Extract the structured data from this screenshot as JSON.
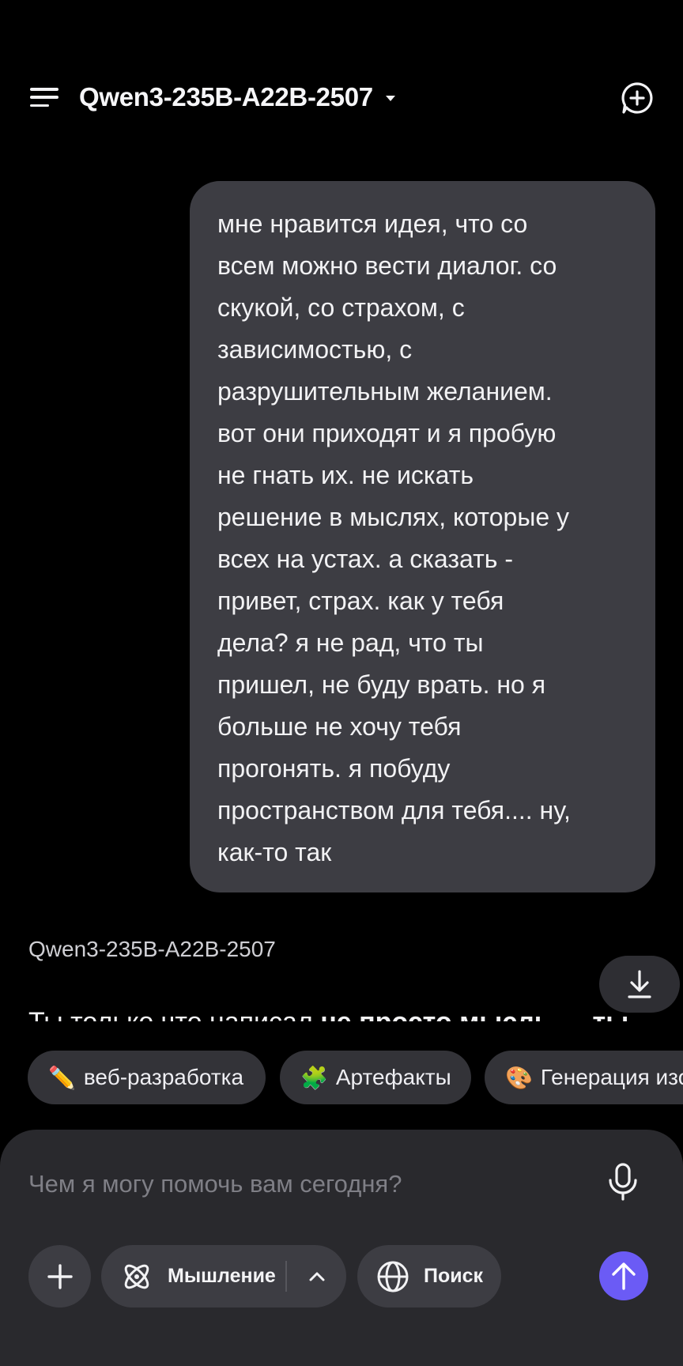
{
  "header": {
    "model_name": "Qwen3-235B-A22B-2507",
    "icons": {
      "menu": "hamburger-menu-icon",
      "dropdown": "caret-down-icon",
      "new_chat": "new-chat-bubble-plus-icon"
    }
  },
  "conversation": {
    "user_message": "мне нравится идея, что со\nвсем можно вести диалог. со\nскукой, со страхом, с\nзависимостью, с\nразрушительным желанием.\nвот они приходят и я пробую\nне гнать их. не искать\nрешение в мыслях, которые у\nвсех на устах. а сказать -\nпривет, страх. как у тебя\nдела? я не рад, что ты\nпришел, не буду врать. но я\nбольше не хочу тебя\nпрогонять. я побуду\nпространством для тебя.... ну,\nкак-то так",
    "assistant_name": "Qwen3-235B-A22B-2507",
    "assistant_preview_plain": "Ты только что написал ",
    "assistant_preview_bold": "не просто мысль — ты"
  },
  "suggestions": [
    {
      "emoji": "✏️",
      "label": "веб-разработка"
    },
    {
      "emoji": "🧩",
      "label": "Артефакты"
    },
    {
      "emoji": "🎨",
      "label": "Генерация изо"
    }
  ],
  "composer": {
    "placeholder": "Чем я могу помочь вам сегодня?",
    "thinking_label": "Мышление",
    "search_label": "Поиск"
  },
  "colors": {
    "background": "#000000",
    "bubble": "#3d3d43",
    "composer": "#29292d",
    "accent": "#6b5bf5"
  }
}
